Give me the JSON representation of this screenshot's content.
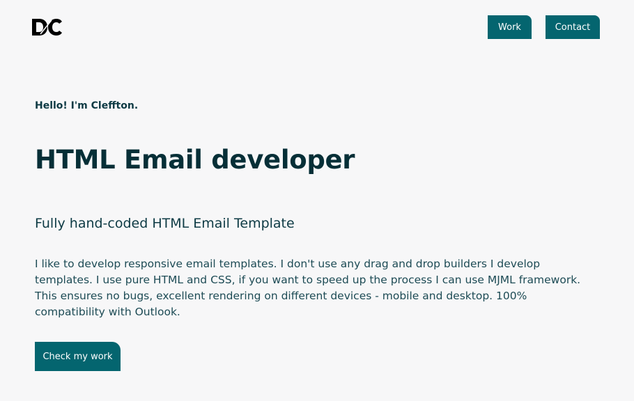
{
  "header": {
    "logo_icon": "dc-logo-icon",
    "nav": {
      "work_label": "Work",
      "contact_label": "Contact"
    }
  },
  "hero": {
    "greeting": "Hello! I'm Cleffton.",
    "headline": "HTML Email developer",
    "subheading": "Fully hand-coded HTML Email Template",
    "description": "I like to develop responsive email templates. I don't use any drag and drop builders I develop templates. I use pure HTML and CSS, if you want to speed up the process I can use MJML framework. This ensures no bugs, excellent rendering on different devices - mobile and desktop. 100% compatibility with Outlook.",
    "cta_label": "Check my work"
  },
  "colors": {
    "accent": "#04656f",
    "background": "#f7f7f8",
    "text": "#0c343d"
  }
}
